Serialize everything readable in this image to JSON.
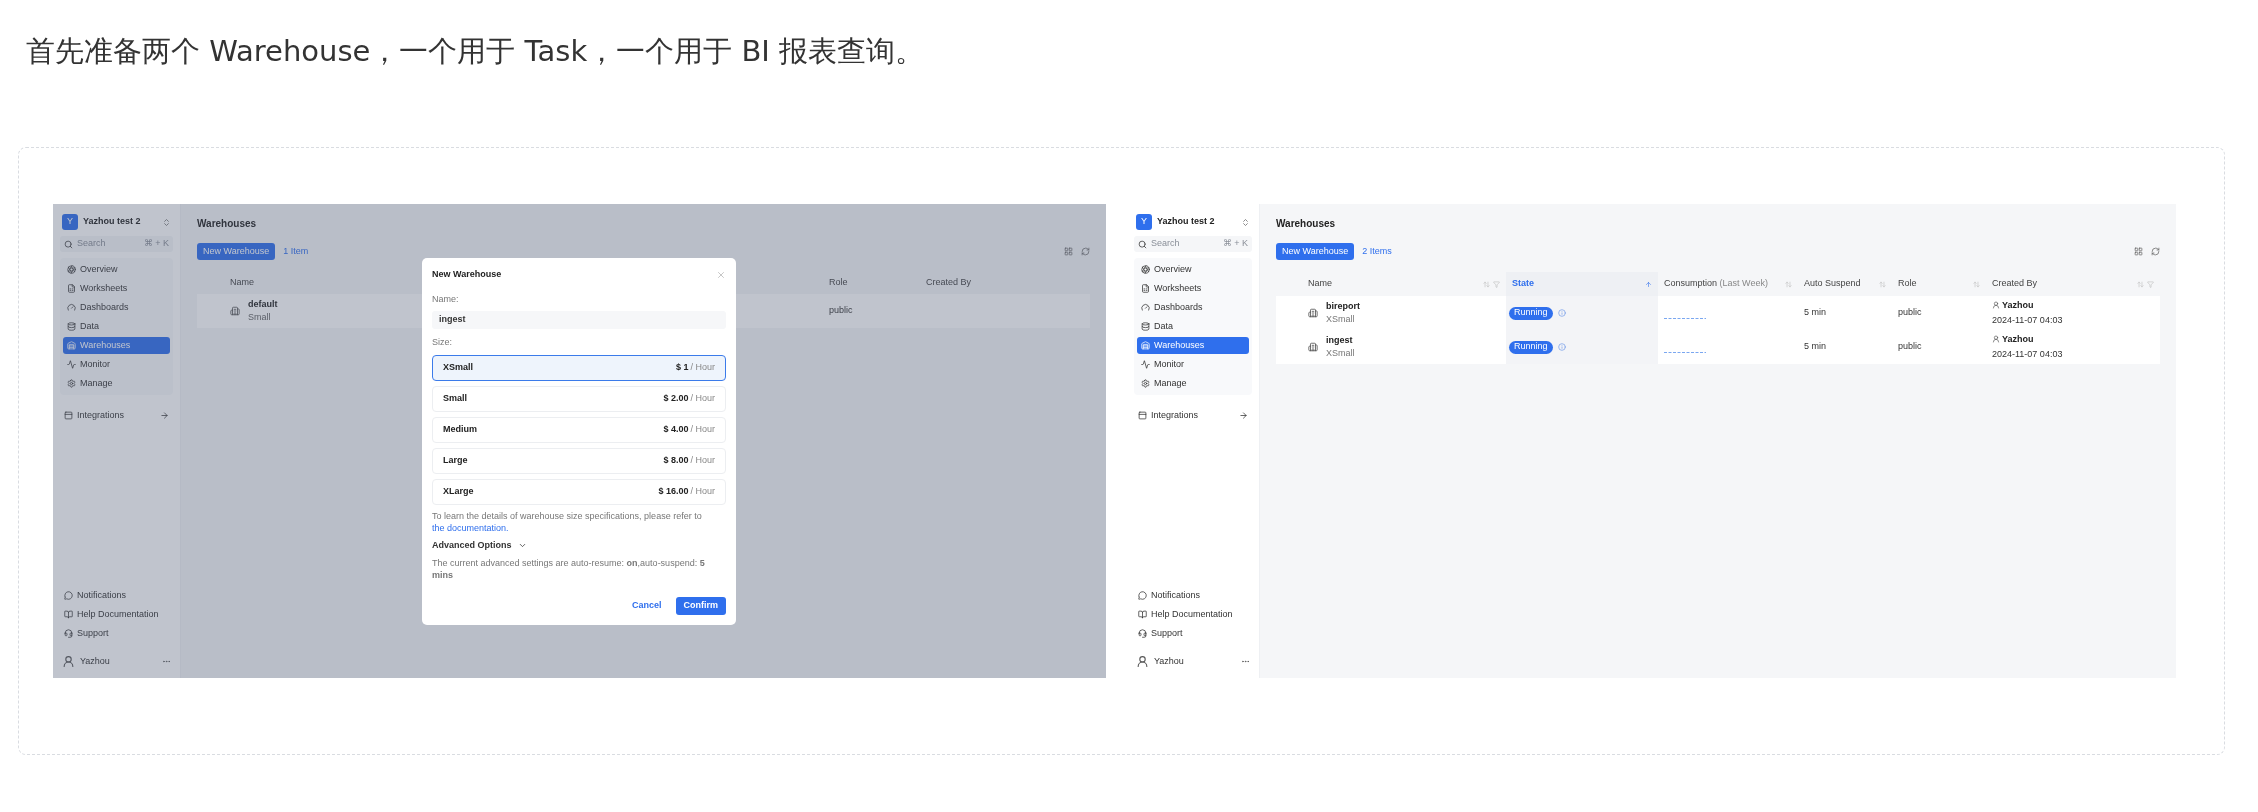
{
  "article": {
    "paragraph": "首先准备两个 Warehouse，一个用于 Task，一个用于 BI 报表查询。"
  },
  "left_screenshot": {
    "sidebar": {
      "org_initial": "Y",
      "org": "Yazhou test 2",
      "search_placeholder": "Search",
      "shortcut": "⌘ + K",
      "items": [
        {
          "label": "Overview",
          "selected": false
        },
        {
          "label": "Worksheets",
          "selected": false
        },
        {
          "label": "Dashboards",
          "selected": false
        },
        {
          "label": "Data",
          "selected": false
        },
        {
          "label": "Warehouses",
          "selected": true
        },
        {
          "label": "Monitor",
          "selected": false
        },
        {
          "label": "Manage",
          "selected": false
        }
      ],
      "integrations": "Integrations",
      "footer": [
        "Notifications",
        "Help Documentation",
        "Support"
      ],
      "user": "Yazhou"
    },
    "title": "Warehouses",
    "new_button": "New Warehouse",
    "count": "1 Item",
    "columns": [
      "Name",
      "Role",
      "Created By"
    ],
    "rows": [
      {
        "name": "default",
        "size": "Small",
        "role": "public"
      }
    ],
    "dialog": {
      "title": "New Warehouse",
      "name_label": "Name:",
      "name_value": "ingest",
      "size_label": "Size:",
      "sizes": [
        {
          "name": "XSmall",
          "price": "$ 1",
          "unit": "/ Hour",
          "selected": true
        },
        {
          "name": "Small",
          "price": "$ 2.00",
          "unit": "/ Hour",
          "selected": false
        },
        {
          "name": "Medium",
          "price": "$ 4.00",
          "unit": "/ Hour",
          "selected": false
        },
        {
          "name": "Large",
          "price": "$ 8.00",
          "unit": "/ Hour",
          "selected": false
        },
        {
          "name": "XLarge",
          "price": "$ 16.00",
          "unit": "/ Hour",
          "selected": false
        }
      ],
      "note": "To learn the details of warehouse size specifications, please refer to ",
      "note_link": "the documentation.",
      "advanced": "Advanced Options",
      "advanced_note": "The current advanced settings are auto-resume: **on**,auto-suspend: **5 mins**",
      "cancel": "Cancel",
      "confirm": "Confirm"
    }
  },
  "right_screenshot": {
    "sidebar": {
      "org_initial": "Y",
      "org": "Yazhou test 2",
      "search_placeholder": "Search",
      "shortcut": "⌘ + K",
      "items": [
        {
          "label": "Overview",
          "selected": false
        },
        {
          "label": "Worksheets",
          "selected": false
        },
        {
          "label": "Dashboards",
          "selected": false
        },
        {
          "label": "Data",
          "selected": false
        },
        {
          "label": "Warehouses",
          "selected": true
        },
        {
          "label": "Monitor",
          "selected": false
        },
        {
          "label": "Manage",
          "selected": false
        }
      ],
      "integrations": "Integrations",
      "footer": [
        "Notifications",
        "Help Documentation",
        "Support"
      ],
      "user": "Yazhou"
    },
    "title": "Warehouses",
    "new_button": "New Warehouse",
    "count": "2 Items",
    "columns": [
      {
        "label": "Name",
        "sorted": false
      },
      {
        "label": "State",
        "sorted": true
      },
      {
        "label": "Consumption",
        "note": "(Last Week)",
        "sorted": false
      },
      {
        "label": "Auto Suspend",
        "sorted": false
      },
      {
        "label": "Role",
        "sorted": false
      },
      {
        "label": "Created By",
        "sorted": false
      }
    ],
    "rows": [
      {
        "name": "bireport",
        "size": "XSmall",
        "state": "Running",
        "auto_suspend": "5 min",
        "role": "public",
        "created_by": "Yazhou",
        "created_at": "2024-11-07 04:03"
      },
      {
        "name": "ingest",
        "size": "XSmall",
        "state": "Running",
        "auto_suspend": "5 min",
        "role": "public",
        "created_by": "Yazhou",
        "created_at": "2024-11-07 04:03"
      }
    ]
  }
}
